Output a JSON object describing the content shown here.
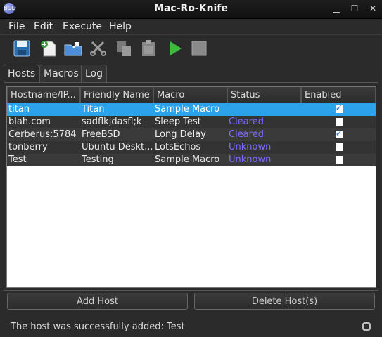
{
  "window": {
    "title": "Mac-Ro-Knife",
    "icon_label": "BDD"
  },
  "menu": [
    {
      "label": "File"
    },
    {
      "label": "Edit"
    },
    {
      "label": "Execute"
    },
    {
      "label": "Help"
    }
  ],
  "toolbar": [
    {
      "name": "save-icon"
    },
    {
      "name": "new-icon"
    },
    {
      "name": "open-icon"
    },
    {
      "name": "cut-icon"
    },
    {
      "name": "copy-icon"
    },
    {
      "name": "paste-icon"
    },
    {
      "name": "run-icon"
    },
    {
      "name": "stop-icon"
    }
  ],
  "tabs": [
    {
      "label": "Hosts"
    },
    {
      "label": "Macros"
    },
    {
      "label": "Log"
    }
  ],
  "table": {
    "columns": [
      "Hostname/IP...",
      "Friendly Name",
      "Macro",
      "Status",
      "Enabled"
    ],
    "rows": [
      {
        "host": "titan",
        "name": "Titan",
        "macro": "Sample Macro",
        "status": "",
        "enabled": true,
        "selected": true
      },
      {
        "host": "blah.com",
        "name": "sadflkjdasfl;k",
        "macro": "Sleep Test",
        "status": "Cleared",
        "enabled": false
      },
      {
        "host": "Cerberus:5784",
        "name": "FreeBSD",
        "macro": "Long Delay",
        "status": "Cleared",
        "enabled": true
      },
      {
        "host": "tonberry",
        "name": "Ubuntu Deskt...",
        "macro": "LotsEchos",
        "status": "Unknown",
        "enabled": false
      },
      {
        "host": "Test",
        "name": "Testing",
        "macro": "Sample Macro",
        "status": "Unknown",
        "enabled": false
      }
    ]
  },
  "buttons": {
    "add_host": "Add Host",
    "delete_host": "Delete Host(s)"
  },
  "status": {
    "message": "The host was successfully added: Test"
  }
}
